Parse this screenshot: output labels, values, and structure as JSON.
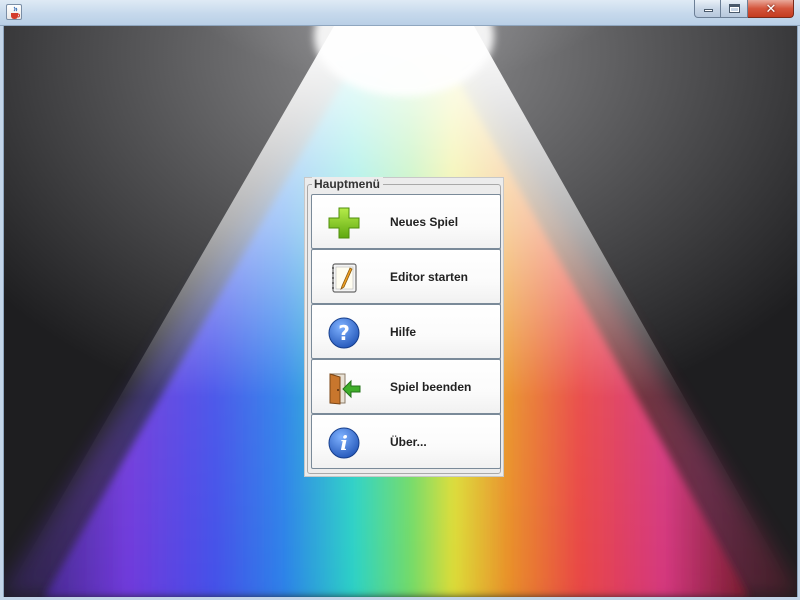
{
  "window": {
    "title": "",
    "app_icon": "java-cup-icon",
    "controls": {
      "minimize": "minimize-icon",
      "maximize": "maximize-icon",
      "close": "close-icon"
    }
  },
  "menu": {
    "legend": "Hauptmenü",
    "items": [
      {
        "label": "Neues Spiel",
        "icon": "plus-icon"
      },
      {
        "label": "Editor starten",
        "icon": "notepad-edit-icon"
      },
      {
        "label": "Hilfe",
        "icon": "help-icon"
      },
      {
        "label": "Spiel beenden",
        "icon": "exit-door-icon"
      },
      {
        "label": "Über...",
        "icon": "info-icon"
      }
    ]
  },
  "colors": {
    "plus": "#7cc41f",
    "help": "#2f6fd6",
    "info": "#2f6fd6",
    "exit_arrow": "#3fae2a",
    "door": "#c8762d"
  }
}
